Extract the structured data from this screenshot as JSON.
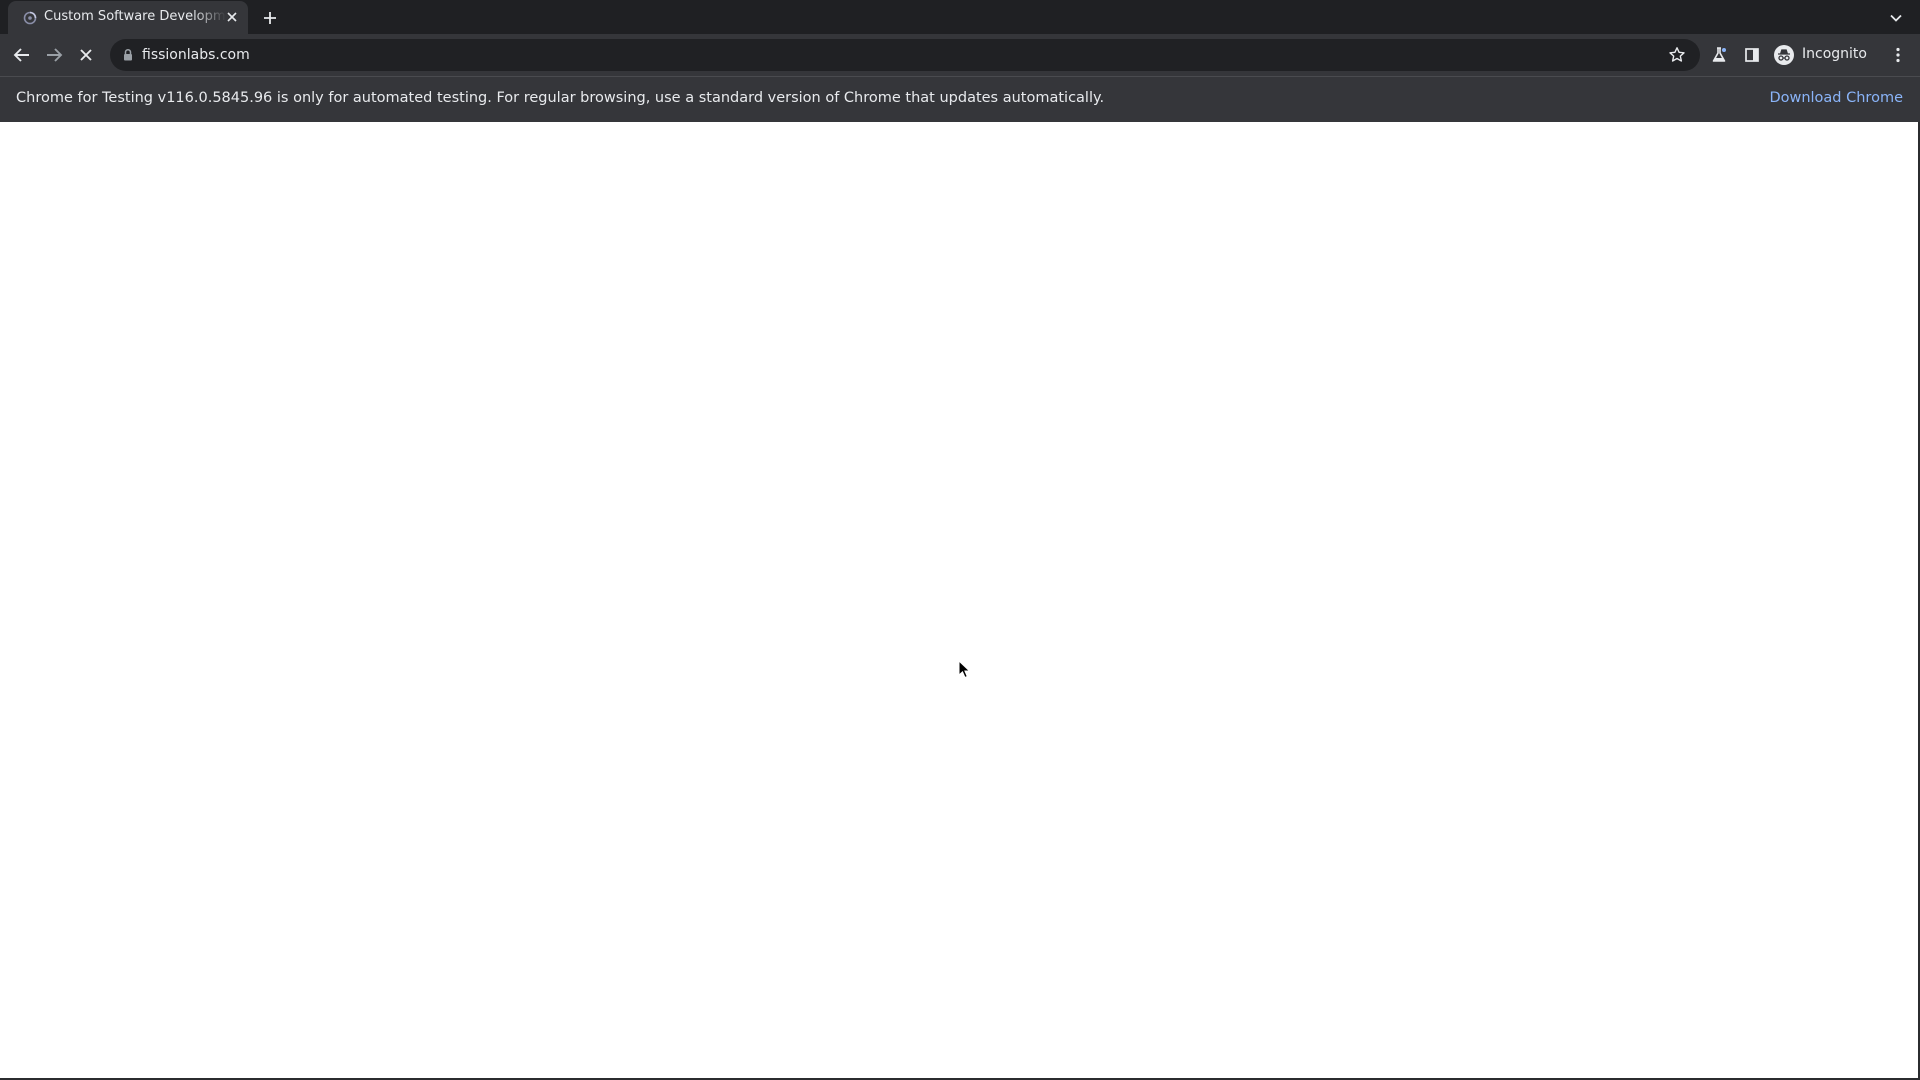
{
  "tab": {
    "title": "Custom Software Development",
    "favicon": "fissionlabs-favicon-icon"
  },
  "toolbar": {
    "url": "fissionlabs.com",
    "profile_label": "Incognito"
  },
  "infobar": {
    "message": "Chrome for Testing v116.0.5845.96 is only for automated testing. For regular browsing, use a standard version of Chrome that updates automatically.",
    "link": "Download Chrome"
  },
  "colors": {
    "tabstrip": "#1f2023",
    "toolbar": "#35363a",
    "omnibox": "#202124",
    "text": "#e8eaed",
    "link": "#8ab4f8"
  }
}
